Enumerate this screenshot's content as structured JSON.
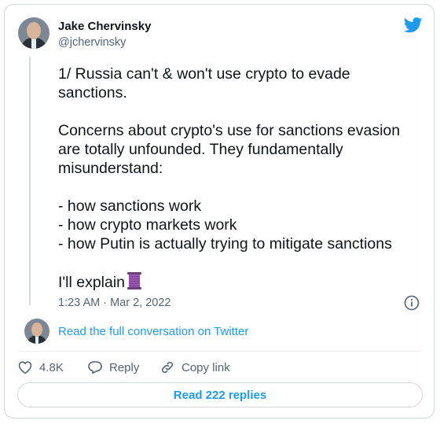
{
  "author": {
    "name": "Jake Chervinsky",
    "handle": "@jchervinsky"
  },
  "tweet": {
    "text": "1/ Russia can't & won't use crypto to evade sanctions.\n\nConcerns about crypto's use for sanctions evasion are totally unfounded. They fundamentally misunderstand:\n\n- how sanctions work\n- how crypto markets work\n- how Putin is actually trying to mitigate sanctions\n\nI'll explain",
    "emoji_icon": "thread-spool-icon",
    "timestamp": "1:23 AM · Mar 2, 2022"
  },
  "conversation_link": "Read the full conversation on Twitter",
  "actions": {
    "likes": "4.8K",
    "reply": "Reply",
    "copy_link": "Copy link"
  },
  "replies_button": "Read 222 replies",
  "colors": {
    "accent": "#1d9bf0",
    "secondary_text": "#536471",
    "border": "#cfd9de"
  }
}
